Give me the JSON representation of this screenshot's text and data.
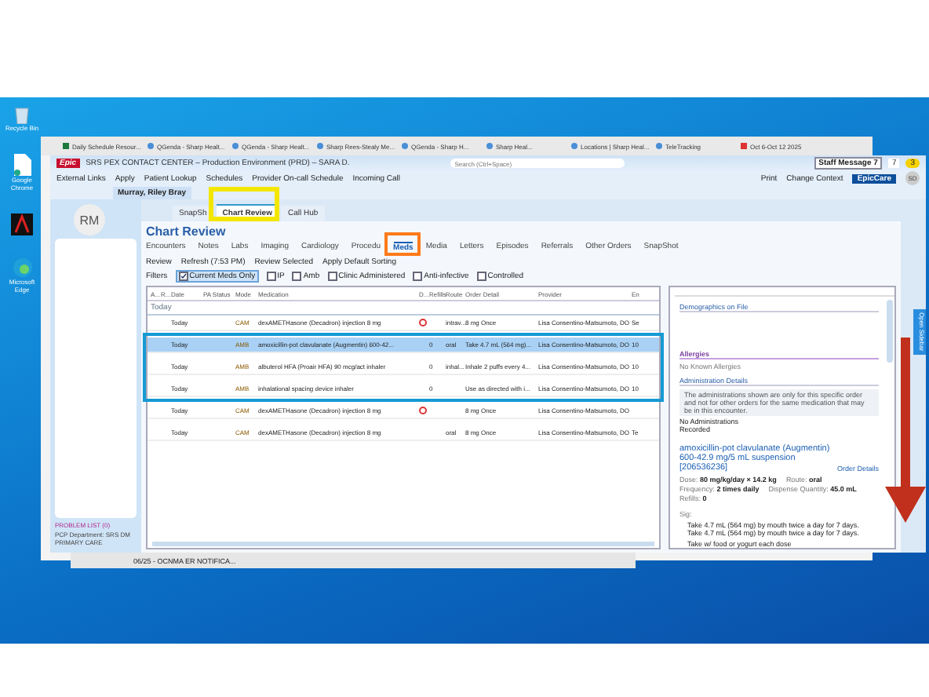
{
  "desktop_icons": [
    {
      "kind": "bin",
      "label": "Recycle Bin"
    },
    {
      "kind": "doc",
      "label": "Google Chrome"
    },
    {
      "kind": "app"
    },
    {
      "kind": "edge",
      "label": "Microsoft Edge"
    }
  ],
  "browser_tabs": [
    {
      "label": "Daily Schedule Resour...",
      "kind": "sheet"
    },
    {
      "label": "QGenda - Sharp Healt...",
      "kind": "web"
    },
    {
      "label": "QGenda - Sharp Healt...",
      "kind": "web"
    },
    {
      "label": "Sharp Rees-Stealy Me...",
      "kind": "web"
    },
    {
      "label": "QGenda - Sharp H...",
      "kind": "web"
    },
    {
      "label": "Sharp Heal...",
      "kind": "web"
    },
    {
      "label": "Locations | Sharp Heal...",
      "kind": "web"
    },
    {
      "label": "TeleTracking",
      "kind": "web"
    },
    {
      "label": "Oct 6-Oct 12 2025",
      "kind": "pdf"
    }
  ],
  "epic": {
    "logo": "Epic",
    "title": "SRS PEX CONTACT CENTER – Production Environment (PRD) – SARA D.",
    "search": {
      "placeholder": "Search (Ctrl+Space)"
    },
    "staff_message": "Staff Message",
    "staff_count": "7",
    "inbox_count": "7",
    "alert_count": "3",
    "toolbar": [
      "External Links",
      "Apply",
      "Patient Lookup",
      "Schedules",
      "Provider On-call Schedule",
      "Incoming Call"
    ],
    "toolbar_right": [
      "Print",
      "Change Context"
    ],
    "badge": "EpicCare",
    "user": "SD",
    "patient_tab": "Murray, Riley Bray"
  },
  "sidebar": {
    "avatar": "RM",
    "problem_list": "PROBLEM LIST (0)",
    "pcp": "PCP Department: SRS DM PRIMARY CARE"
  },
  "activity_tabs": [
    {
      "label": "SnapSh",
      "selected": false
    },
    {
      "label": "Chart Review",
      "selected": true
    },
    {
      "label": "Call Hub",
      "selected": false
    }
  ],
  "chart_review": {
    "title": "Chart Review",
    "tabs": [
      {
        "label": "Encounters",
        "selected": false
      },
      {
        "label": "Notes",
        "selected": false
      },
      {
        "label": "Labs",
        "selected": false
      },
      {
        "label": "Imaging",
        "selected": false
      },
      {
        "label": "Cardiology",
        "selected": false
      },
      {
        "label": "Procedu",
        "selected": false
      },
      {
        "label": "Meds",
        "selected": true
      },
      {
        "label": "Media",
        "selected": false
      },
      {
        "label": "Letters",
        "selected": false
      },
      {
        "label": "Episodes",
        "selected": false
      },
      {
        "label": "Referrals",
        "selected": false
      },
      {
        "label": "Other Orders",
        "selected": false
      },
      {
        "label": "SnapShot",
        "selected": false
      }
    ],
    "actions": [
      "Review",
      "Refresh (7:53 PM)",
      "Review Selected",
      "Apply Default Sorting"
    ],
    "filters_label": "Filters",
    "filters": [
      {
        "label": "Current Meds Only",
        "checked": true
      },
      {
        "label": "IP",
        "checked": false
      },
      {
        "label": "Amb",
        "checked": false
      },
      {
        "label": "Clinic Administered",
        "checked": false
      },
      {
        "label": "Anti-infective",
        "checked": false
      },
      {
        "label": "Controlled",
        "checked": false
      }
    ],
    "columns": [
      "A...",
      "R...",
      "Date",
      "PA Status",
      "Mode",
      "Medication",
      "D...",
      "Refills",
      "Route",
      "Order Detail",
      "Provider",
      "En"
    ],
    "group": "Today",
    "rows": [
      {
        "date": "Today",
        "mode": "CAM",
        "medication": "dexAMETHasone (Decadron) injection 8 mg",
        "flag": true,
        "refills": "",
        "route": "intrav...",
        "detail": "8 mg Once",
        "provider": "Lisa Consentino-Matsumoto, DO",
        "en": "Se",
        "selected": false
      },
      {
        "date": "Today",
        "mode": "AMB",
        "medication": "amoxicillin-pot clavulanate (Augmentin) 600-42...",
        "flag": false,
        "refills": "0",
        "route": "oral",
        "detail": "Take 4.7 mL (564 mg)...",
        "provider": "Lisa Consentino-Matsumoto, DO",
        "en": "10",
        "selected": true
      },
      {
        "date": "Today",
        "mode": "AMB",
        "medication": "albuterol HFA (Proair HFA) 90 mcg/act inhaler",
        "flag": false,
        "refills": "0",
        "route": "inhal...",
        "detail": "Inhale 2 puffs every 4...",
        "provider": "Lisa Consentino-Matsumoto, DO",
        "en": "10",
        "selected": false
      },
      {
        "date": "Today",
        "mode": "AMB",
        "medication": "inhalational spacing device inhaler",
        "flag": false,
        "refills": "0",
        "route": "",
        "detail": "Use as directed with i...",
        "provider": "Lisa Consentino-Matsumoto, DO",
        "en": "10",
        "selected": false
      },
      {
        "date": "Today",
        "mode": "CAM",
        "medication": "dexAMETHasone (Decadron) injection 8 mg",
        "flag": true,
        "refills": "",
        "route": "",
        "detail": "8 mg Once",
        "provider": "Lisa Consentino-Matsumoto, DO",
        "en": "",
        "selected": false
      },
      {
        "date": "Today",
        "mode": "CAM",
        "medication": "dexAMETHasone (Decadron) injection 8 mg",
        "flag": false,
        "refills": "",
        "route": "oral",
        "detail": "8 mg Once",
        "provider": "Lisa Consentino-Matsumoto, DO",
        "en": "Te",
        "selected": false
      }
    ]
  },
  "detail_pane": {
    "demographics": "Demographics on File",
    "allergies": "Allergies",
    "allergies_value": "No Known Allergies",
    "admin_heading": "Administration Details",
    "admin_note": "The administrations shown are only for this specific order and not for other orders for the same medication that may be in this encounter.",
    "admin_value": "No Administrations Recorded",
    "order_title": "amoxicillin-pot clavulanate (Augmentin) 600-42.9 mg/5 mL suspension [206536236]",
    "order_link": "Order Details",
    "fields": [
      {
        "label": "Dose:",
        "value": "80 mg/kg/day × 14.2 kg"
      },
      {
        "label": "Route:",
        "value": "oral"
      },
      {
        "label": "Frequency:",
        "value": "2 times daily"
      },
      {
        "label": "Dispense Quantity:",
        "value": "45.0 mL"
      },
      {
        "label": "Refills:",
        "value": "0"
      }
    ],
    "sig_label": "Sig:",
    "sig": [
      "Take 4.7 mL (564 mg) by mouth twice a day for 7 days. Take 4.7 mL (564 mg) by mouth twice a day for 7 days.",
      "Take w/ food or yogurt each dose"
    ]
  },
  "open_sidebar": "Open Sidebar",
  "taskbar_item": "06/25 - OCNMA ER NOTIFICA..."
}
